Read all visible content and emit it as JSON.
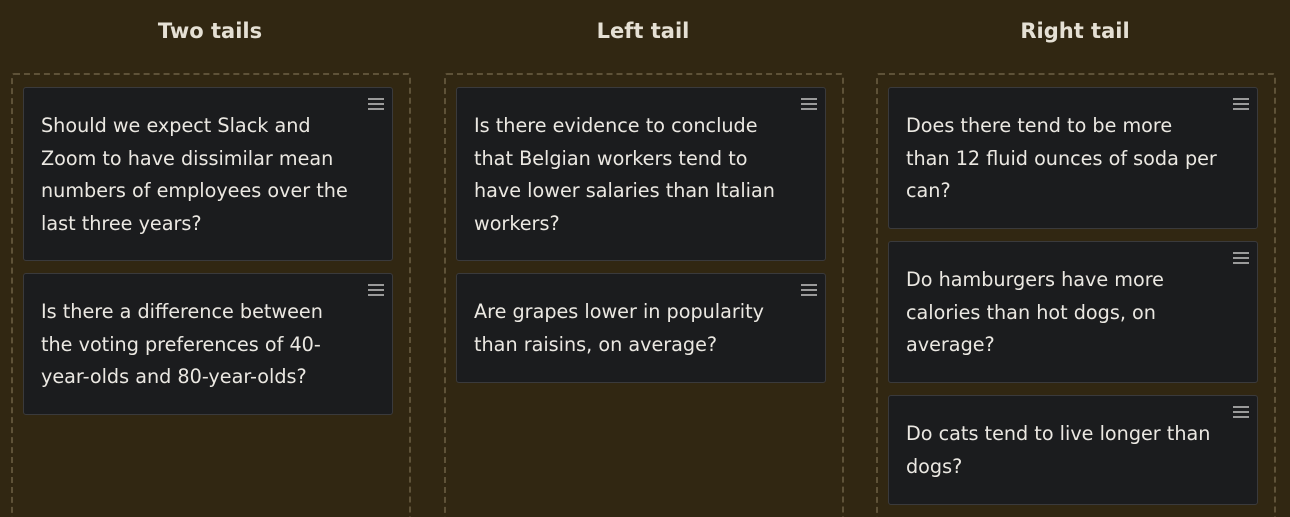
{
  "columns": [
    {
      "title": "Two tails",
      "cards": [
        {
          "text": "Should we expect Slack and\nZoom to have dissimilar mean\nnumbers of employees over the\nlast three years?",
          "handle_icon": "drag-handle-icon"
        },
        {
          "text": "Is there a difference between\nthe voting preferences of 40-\nyear-olds and 80-year-olds?",
          "handle_icon": "drag-handle-icon"
        }
      ]
    },
    {
      "title": "Left tail",
      "cards": [
        {
          "text": "Is there evidence to conclude\nthat Belgian workers tend to\nhave lower salaries than Italian\nworkers?",
          "handle_icon": "drag-handle-icon"
        },
        {
          "text": "Are grapes lower in popularity\nthan raisins, on average?",
          "handle_icon": "drag-handle-icon"
        }
      ]
    },
    {
      "title": "Right tail",
      "cards": [
        {
          "text": "Does there tend to be more\nthan 12 fluid ounces of soda per\ncan?",
          "handle_icon": "drag-handle-icon"
        },
        {
          "text": "Do hamburgers have more\ncalories than hot dogs, on\naverage?",
          "handle_icon": "drag-handle-icon"
        },
        {
          "text": "Do cats tend to live longer than\ndogs?",
          "handle_icon": "drag-handle-icon"
        }
      ]
    }
  ],
  "colors": {
    "background": "#312712",
    "card": "#1b1c1e",
    "text": "#ebe8e2",
    "dashed_border": "#5e5238"
  }
}
